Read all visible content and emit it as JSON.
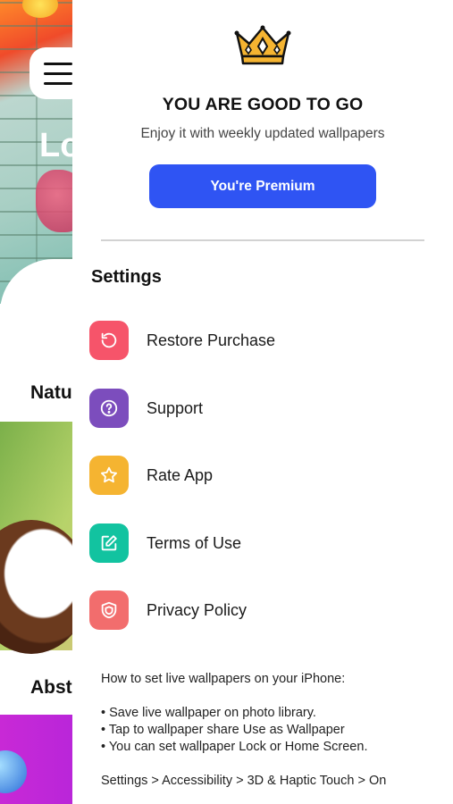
{
  "background": {
    "hero_title": "Lo",
    "sections": [
      "Natu",
      "Abst"
    ]
  },
  "drawer": {
    "title": "YOU ARE GOOD TO GO",
    "subtitle": "Enjoy it with weekly updated wallpapers",
    "premium_button": "You're Premium",
    "settings_heading": "Settings",
    "items": [
      {
        "label": "Restore Purchase",
        "icon": "restore-icon",
        "color": "#f6546a"
      },
      {
        "label": "Support",
        "icon": "question-icon",
        "color": "#7c4dbd"
      },
      {
        "label": "Rate App",
        "icon": "star-icon",
        "color": "#f5b431"
      },
      {
        "label": "Terms of Use",
        "icon": "edit-icon",
        "color": "#12c3a0"
      },
      {
        "label": "Privacy Policy",
        "icon": "shield-icon",
        "color": "#f26d6d"
      }
    ],
    "howto": {
      "heading": "How to set live wallpapers on your iPhone:",
      "steps": [
        "• Save live wallpaper on photo library.",
        "• Tap to wallpaper share Use as Wallpaper",
        "• You can set wallpaper Lock or Home Screen."
      ],
      "path": "Settings > Accessibility > 3D & Haptic Touch > On"
    }
  },
  "colors": {
    "accent": "#2f54f3",
    "crown_gold": "#f5b431"
  }
}
